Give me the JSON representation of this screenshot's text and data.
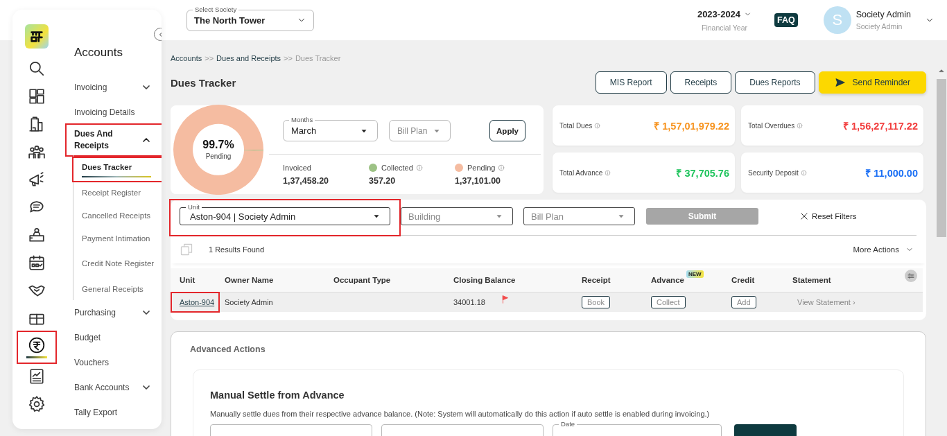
{
  "sidebar": {
    "rail": [
      {
        "selected": false,
        "highlighted": false
      },
      {
        "selected": false,
        "highlighted": false
      },
      {
        "selected": false,
        "highlighted": false
      },
      {
        "selected": false,
        "highlighted": false
      },
      {
        "selected": false,
        "highlighted": false
      },
      {
        "selected": false,
        "highlighted": false
      },
      {
        "selected": false,
        "highlighted": false
      },
      {
        "selected": false,
        "highlighted": false
      },
      {
        "selected": false,
        "highlighted": false
      },
      {
        "selected": false,
        "highlighted": false
      },
      {
        "selected": true,
        "highlighted": true
      },
      {
        "selected": false,
        "highlighted": false
      },
      {
        "selected": false,
        "highlighted": false
      }
    ],
    "menu": {
      "title": "Accounts",
      "items": [
        {
          "label": "Invoicing",
          "kind": "group",
          "expanded": false,
          "highlighted": false
        },
        {
          "label": "Invoicing Details",
          "kind": "link",
          "highlighted": false
        },
        {
          "label": "Dues And Receipts",
          "kind": "group",
          "expanded": true,
          "highlighted": true,
          "children": [
            {
              "label": "Dues Tracker",
              "selected": true,
              "highlighted": true
            },
            {
              "label": "Receipt Register",
              "selected": false,
              "highlighted": false
            },
            {
              "label": "Cancelled Receipts",
              "selected": false,
              "highlighted": false
            },
            {
              "label": "Payment Intimation",
              "selected": false,
              "highlighted": false
            },
            {
              "label": "Credit Note Register",
              "selected": false,
              "highlighted": false
            },
            {
              "label": "General Receipts",
              "selected": false,
              "highlighted": false
            }
          ]
        },
        {
          "label": "Purchasing",
          "kind": "group",
          "expanded": false,
          "highlighted": false
        },
        {
          "label": "Budget",
          "kind": "link",
          "highlighted": false
        },
        {
          "label": "Vouchers",
          "kind": "link",
          "highlighted": false
        },
        {
          "label": "Bank Accounts",
          "kind": "group",
          "expanded": false,
          "highlighted": false
        },
        {
          "label": "Tally Export",
          "kind": "link",
          "highlighted": false
        }
      ]
    }
  },
  "header": {
    "society": {
      "label": "Select Society",
      "value": "The North Tower"
    },
    "year": {
      "value": "2023-2024",
      "caption": "Financial Year"
    },
    "faq": "FAQ",
    "user": {
      "initial": "S",
      "name": "Society Admin",
      "role": "Society Admin"
    }
  },
  "breadcrumb": [
    {
      "text": "Accounts",
      "current": false
    },
    {
      "text": ">>",
      "kind": "separator"
    },
    {
      "text": "Dues and Receipts",
      "current": false
    },
    {
      "text": ">>",
      "kind": "separator"
    },
    {
      "text": "Dues Tracker",
      "current": true
    }
  ],
  "page_title": "Dues Tracker",
  "actions": [
    {
      "label": "MIS Report",
      "kind": "outline"
    },
    {
      "label": "Receipts",
      "kind": "outline"
    },
    {
      "label": "Dues Reports",
      "kind": "outline"
    },
    {
      "label": "Send Reminder",
      "kind": "primary"
    }
  ],
  "summary": {
    "donut": {
      "level": 0.997,
      "value": "99.7%",
      "label": "Pending"
    },
    "months": {
      "label": "Months",
      "value": "March"
    },
    "bill_plan": {
      "placeholder": "Bill Plan"
    },
    "apply": "Apply",
    "stats": [
      {
        "label": "Invoiced",
        "value": "1,37,458.20",
        "info": false
      },
      {
        "label": "Collected",
        "value": "357.20",
        "color": "#9dc285",
        "info": true
      },
      {
        "label": "Pending",
        "value": "1,37,101.00",
        "color": "#f5bca1",
        "info": true
      }
    ]
  },
  "totals": [
    {
      "label": "Total Dues",
      "value": "₹ 1,57,01,979.22",
      "color": "#f7931e"
    },
    {
      "label": "Total Overdues",
      "value": "₹ 1,56,27,117.22",
      "color": "#f23c3c"
    },
    {
      "label": "Total Advance",
      "value": "₹ 37,705.76",
      "color": "#1ec45c"
    },
    {
      "label": "Security Deposit",
      "value": "₹ 11,000.00",
      "color": "#1a6ff5"
    }
  ],
  "filters": {
    "fields": [
      {
        "label": "Unit",
        "value": "Aston-904 | Society Admin",
        "highlighted": true
      },
      {
        "placeholder": "Building",
        "highlighted": false
      },
      {
        "placeholder": "Bill Plan",
        "highlighted": false
      }
    ],
    "submit": {
      "label": "Submit",
      "disabled": true
    },
    "reset": "Reset Filters"
  },
  "results": {
    "count_text": "1 Results Found",
    "more_actions": "More Actions"
  },
  "table": {
    "columns": [
      {
        "label": "Unit"
      },
      {
        "label": "Owner Name"
      },
      {
        "label": "Occupant Type"
      },
      {
        "label": "Closing Balance"
      },
      {
        "label": "Receipt"
      },
      {
        "label": "Advance",
        "badge": "NEW"
      },
      {
        "label": "Credit"
      },
      {
        "label": "Statement"
      }
    ],
    "rows": [
      {
        "cells": [
          {
            "kind": "link",
            "text": "Aston-904",
            "highlighted": true
          },
          {
            "kind": "text",
            "text": "Society Admin"
          },
          {
            "kind": "blank"
          },
          {
            "kind": "flagged",
            "text": "34001.18"
          },
          {
            "kind": "button",
            "text": "Book"
          },
          {
            "kind": "button",
            "text": "Collect"
          },
          {
            "kind": "button",
            "text": "Add"
          },
          {
            "kind": "more-link",
            "text": "View Statement ›"
          }
        ]
      }
    ]
  },
  "advanced": {
    "title": "Advanced Actions",
    "panel": {
      "title": "Manual Settle from Advance",
      "description": "Manually settle dues from their respective advance balance. (Note: System will automatically do this action if auto settle is enabled during invoicing.)",
      "fields": [
        {
          "kind": "field"
        },
        {
          "kind": "field"
        },
        {
          "kind": "date",
          "label": "Date"
        },
        {
          "kind": "button"
        }
      ]
    }
  }
}
